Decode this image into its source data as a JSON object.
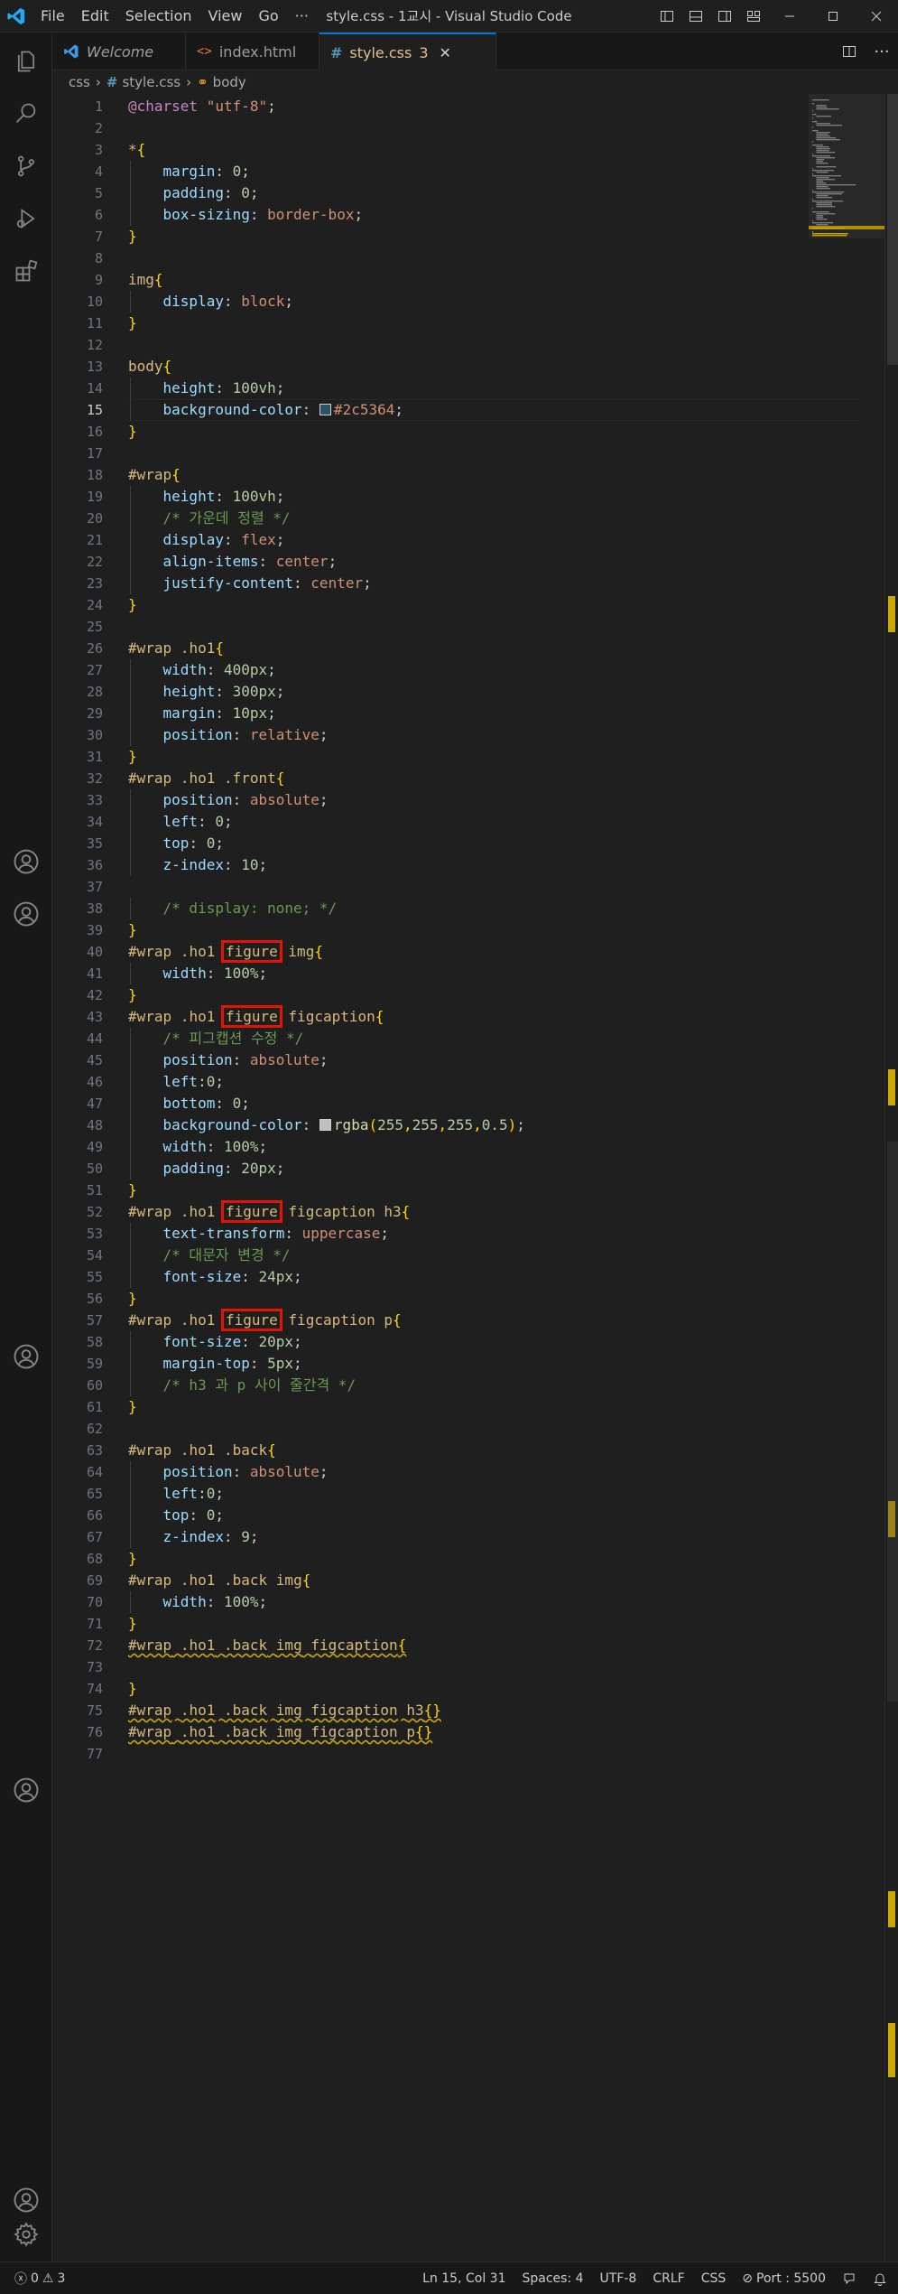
{
  "window": {
    "title": "style.css - 1교시 - Visual Studio Code",
    "menus": [
      "File",
      "Edit",
      "Selection",
      "View",
      "Go",
      "···"
    ]
  },
  "tabs": [
    {
      "label": "Welcome",
      "italic": true
    },
    {
      "label": "index.html"
    },
    {
      "label": "style.css",
      "modified_count": "3",
      "active": true
    }
  ],
  "breadcrumb": [
    "css",
    "style.css",
    "body"
  ],
  "editor": {
    "active_line": 15,
    "lines": [
      "@charset \"utf-8\";",
      "",
      "*{",
      "    margin: 0;",
      "    padding: 0;",
      "    box-sizing: border-box;",
      "}",
      "",
      "img{",
      "    display: block;",
      "}",
      "",
      "body{",
      "    height: 100vh;",
      "    background-color: #2c5364;",
      "}",
      "",
      "#wrap{",
      "    height: 100vh;",
      "    /* 가운데 정렬 */",
      "    display: flex;",
      "    align-items: center;",
      "    justify-content: center;",
      "}",
      "",
      "#wrap .ho1{",
      "    width: 400px;",
      "    height: 300px;",
      "    margin: 10px;",
      "    position: relative;",
      "}",
      "#wrap .ho1 .front{",
      "    position: absolute;",
      "    left: 0;",
      "    top: 0;",
      "    z-index: 10;",
      "",
      "    /* display: none; */",
      "}",
      "#wrap .ho1 figure img{",
      "    width: 100%;",
      "}",
      "#wrap .ho1 figure figcaption{",
      "    /* 피그캡션 수정 */",
      "    position: absolute;",
      "    left:0;",
      "    bottom: 0;",
      "    background-color: rgba(255,255,255,0.5);",
      "    width: 100%;",
      "    padding: 20px;",
      "}",
      "#wrap .ho1 figure figcaption h3{",
      "    text-transform: uppercase;",
      "    /* 대문자 변경 */",
      "    font-size: 24px;",
      "}",
      "#wrap .ho1 figure figcaption p{",
      "    font-size: 20px;",
      "    margin-top: 5px;",
      "    /* h3 과 p 사이 줄간격 */",
      "}",
      "",
      "#wrap .ho1 .back{",
      "    position: absolute;",
      "    left:0;",
      "    top: 0;",
      "    z-index: 9;",
      "}",
      "#wrap .ho1 .back img{",
      "    width: 100%;",
      "}",
      "#wrap .ho1 .back img figcaption{",
      "",
      "}",
      "#wrap .ho1 .back img figcaption h3{}",
      "#wrap .ho1 .back img figcaption p{}",
      ""
    ]
  },
  "status": {
    "errors": "0",
    "warnings": "3",
    "position": "Ln 15, Col 31",
    "spaces": "Spaces: 4",
    "encoding": "UTF-8",
    "eol": "CRLF",
    "language": "CSS",
    "port": "Port : 5500"
  },
  "colors": {
    "accent": "#0078d4",
    "highlight_box": "#e51400",
    "warning": "#cca700",
    "swatch_body_bg": "#2c5364",
    "swatch_rgba": "#bfbfbf"
  }
}
